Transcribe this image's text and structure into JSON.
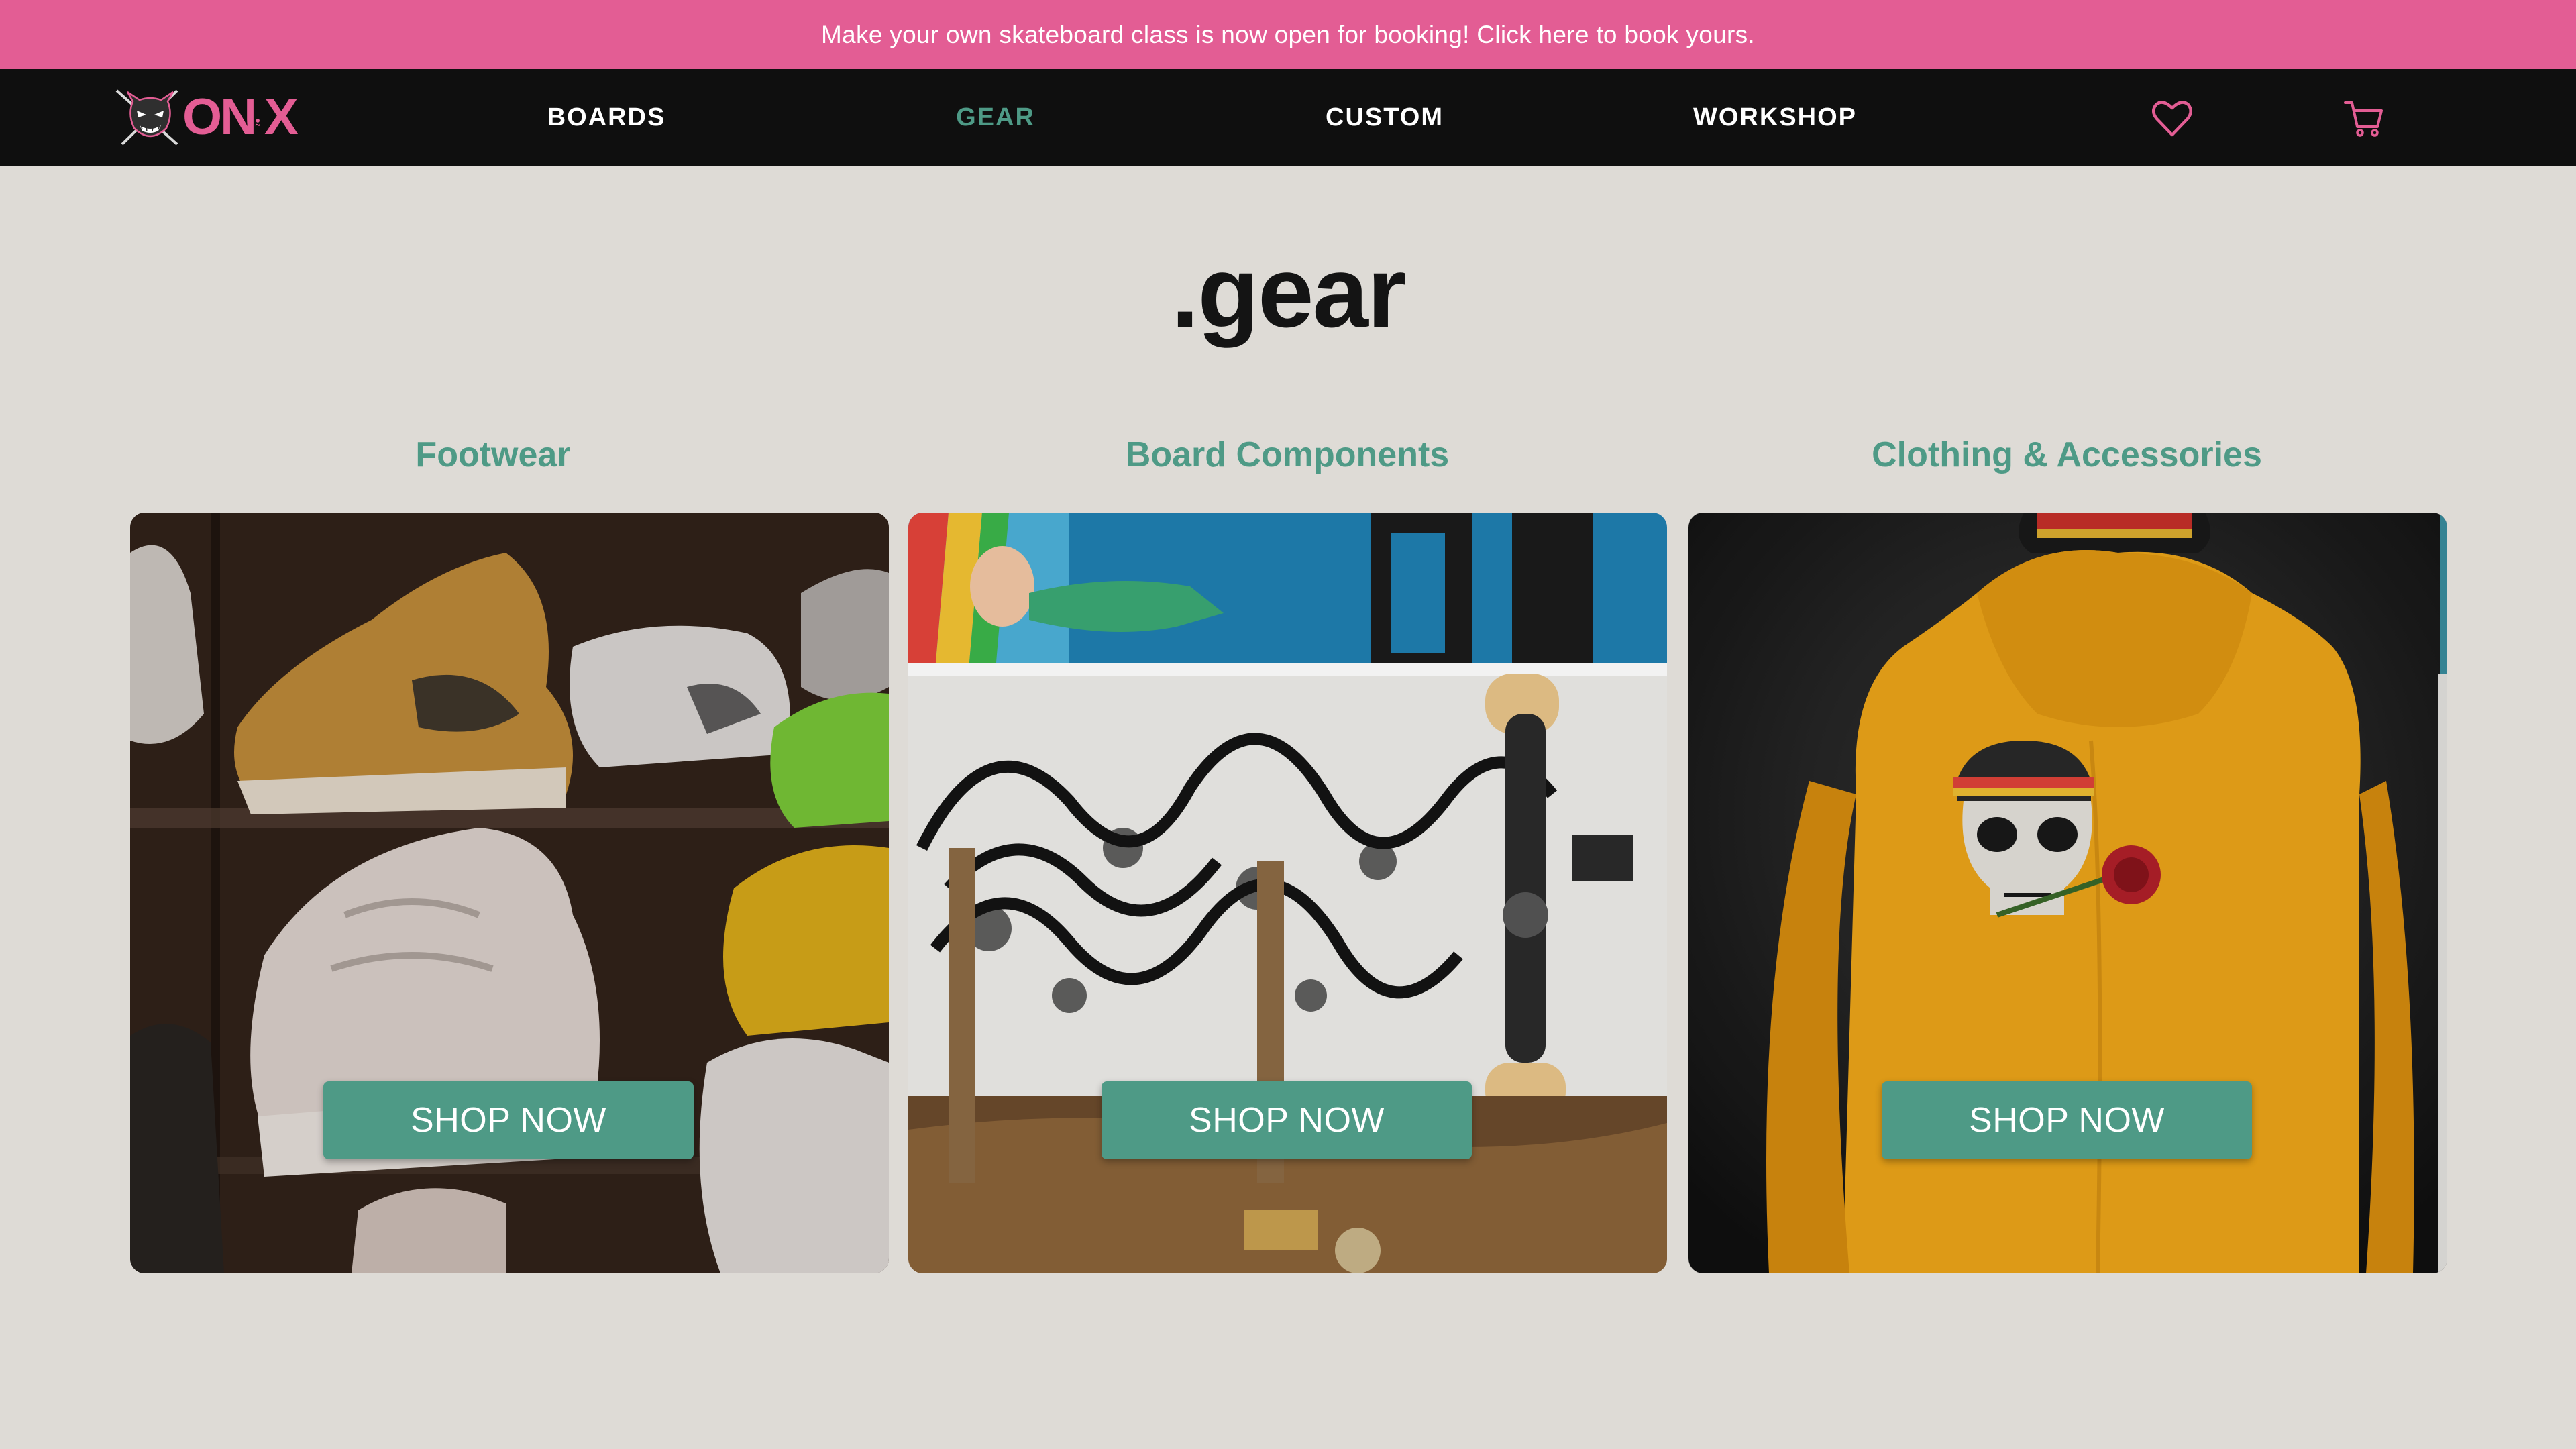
{
  "banner": {
    "text": "Make your own skateboard class is now open for booking! Click here to book yours."
  },
  "nav": {
    "logo": {
      "text_pink": "ON",
      "text_small": "ꔸ",
      "text_x": "X"
    },
    "links": [
      {
        "label": "BOARDS",
        "active": false
      },
      {
        "label": "GEAR",
        "active": true
      },
      {
        "label": "CUSTOM",
        "active": false
      },
      {
        "label": "WORKSHOP",
        "active": false
      }
    ],
    "icons": [
      "heart-icon",
      "cart-icon"
    ]
  },
  "page": {
    "title": ".gear"
  },
  "categories": [
    {
      "title": "Footwear",
      "button": "SHOP NOW",
      "image": "sneakers-on-shelves"
    },
    {
      "title": "Board Components",
      "button": "SHOP NOW",
      "image": "skateboard-deck-and-truck"
    },
    {
      "title": "Clothing & Accessories",
      "button": "SHOP NOW",
      "image": "yellow-hoodie-skull-print"
    }
  ],
  "colors": {
    "banner": "#e35d94",
    "nav_bg": "#0f0f0f",
    "accent": "#4e9a86",
    "page_bg": "#dedbd6",
    "title": "#141414"
  }
}
